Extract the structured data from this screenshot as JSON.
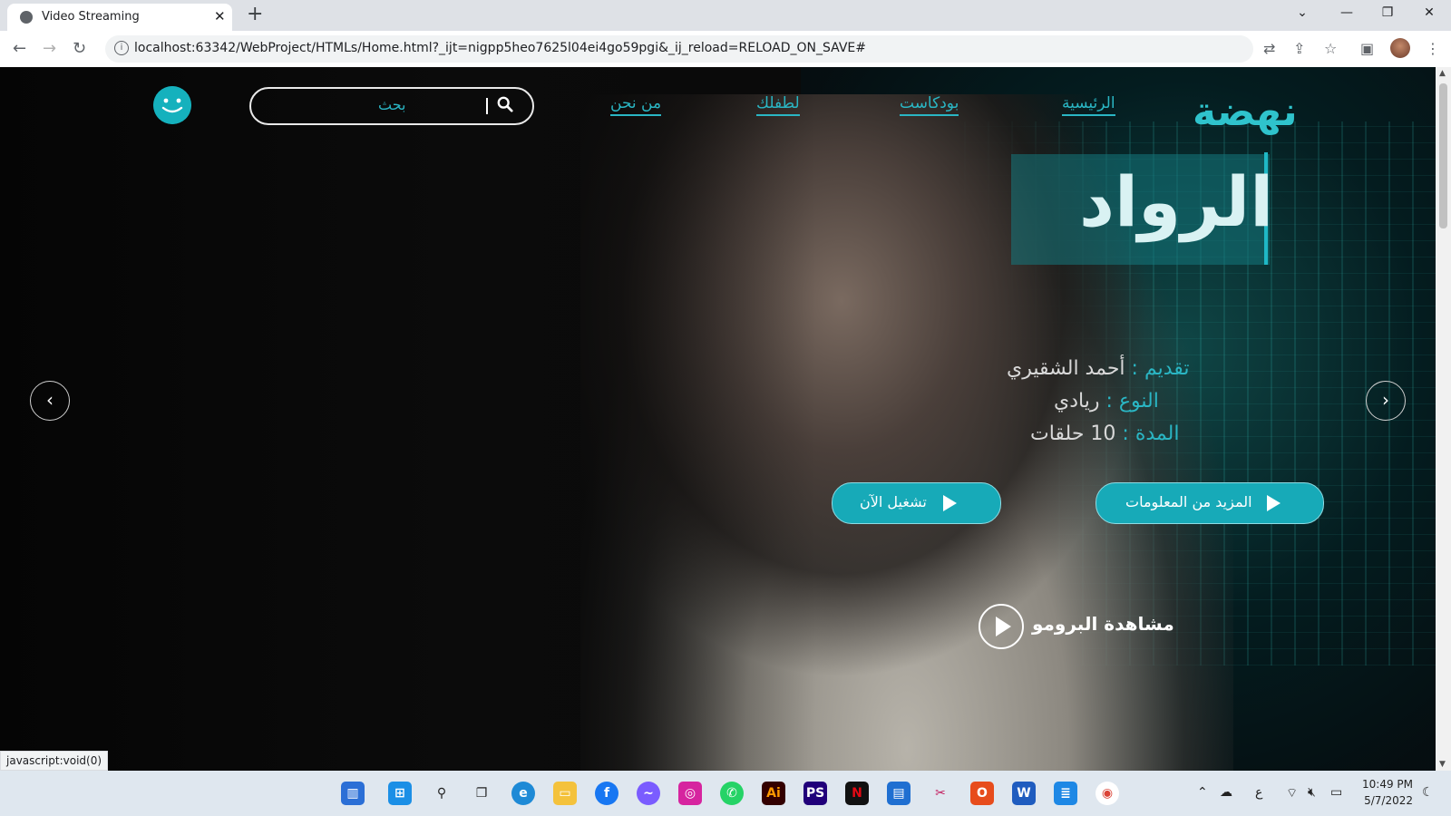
{
  "browser": {
    "tab_title": "Video Streaming",
    "tab_close": "✕",
    "new_tab": "+",
    "url": "localhost:63342/WebProject/HTMLs/Home.html?_ijt=nigpp5heo7625l04ei4go59pgi&_ij_reload=RELOAD_ON_SAVE#",
    "status_text": "javascript:void(0)"
  },
  "site": {
    "logo": "نهضة",
    "nav": {
      "home": "الرئيسية",
      "podcast": "بودكاست",
      "kids": "لطفلك",
      "about": "من نحن"
    },
    "search_placeholder": "بحث"
  },
  "hero": {
    "title": "الرواد",
    "presenter_key": "تقديم :",
    "presenter_val": " أحمد الشقيري",
    "genre_key": "النوع :",
    "genre_val": " ريادي",
    "duration_key": "المدة :",
    "duration_val": " 10 حلقات",
    "more_info_button": "المزيد من المعلومات",
    "play_now_button": "تشغيل الآن",
    "promo_label": "مشاهدة البرومو",
    "prev_arrow": "‹",
    "next_arrow": "›"
  },
  "taskbar": {
    "time": "10:49 PM",
    "date": "5/7/2022",
    "lang": "ع"
  },
  "colors": {
    "accent": "#17aab8",
    "logo": "#2fc3cc"
  }
}
